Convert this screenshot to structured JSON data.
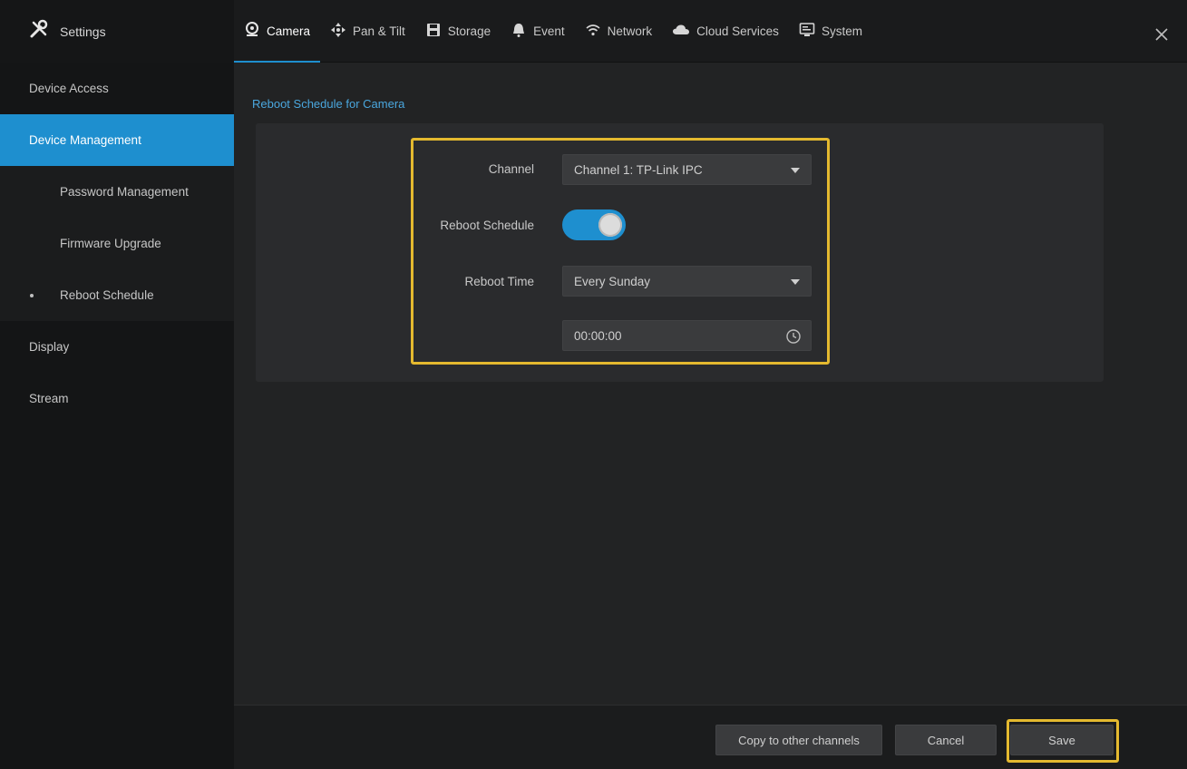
{
  "header": {
    "title": "Settings",
    "tabs": [
      {
        "label": "Camera",
        "icon": "camera-icon",
        "active": true
      },
      {
        "label": "Pan & Tilt",
        "icon": "pan-tilt-icon",
        "active": false
      },
      {
        "label": "Storage",
        "icon": "storage-icon",
        "active": false
      },
      {
        "label": "Event",
        "icon": "event-bell-icon",
        "active": false
      },
      {
        "label": "Network",
        "icon": "wifi-icon",
        "active": false
      },
      {
        "label": "Cloud Services",
        "icon": "cloud-icon",
        "active": false
      },
      {
        "label": "System",
        "icon": "system-monitor-icon",
        "active": false
      }
    ],
    "close_icon": "close-icon"
  },
  "sidebar": {
    "items": [
      {
        "label": "Device Access",
        "active": false,
        "sub": false
      },
      {
        "label": "Device Management",
        "active": true,
        "sub": false
      },
      {
        "label": "Password Management",
        "active": false,
        "sub": true
      },
      {
        "label": "Firmware Upgrade",
        "active": false,
        "sub": true
      },
      {
        "label": "Reboot Schedule",
        "active": false,
        "sub": true,
        "selected": true
      },
      {
        "label": "Display",
        "active": false,
        "sub": false
      },
      {
        "label": "Stream",
        "active": false,
        "sub": false
      }
    ]
  },
  "main": {
    "section_title": "Reboot Schedule for Camera",
    "form": {
      "channel_label": "Channel",
      "channel_value": "Channel 1: TP-Link IPC",
      "reboot_schedule_label": "Reboot Schedule",
      "reboot_schedule_enabled": true,
      "reboot_time_label": "Reboot Time",
      "reboot_time_value": "Every Sunday",
      "time_value": "00:00:00"
    }
  },
  "footer": {
    "copy_label": "Copy to other channels",
    "cancel_label": "Cancel",
    "save_label": "Save"
  },
  "colors": {
    "accent": "#1e8fcf",
    "highlight": "#e4b92f",
    "section_title": "#4aa7de"
  }
}
